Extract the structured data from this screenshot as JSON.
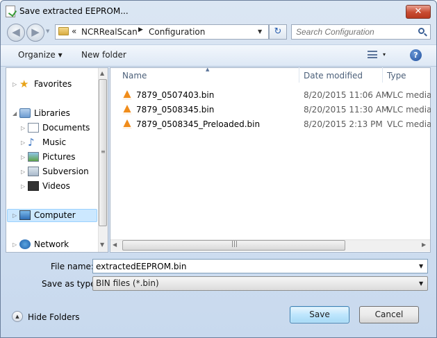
{
  "window": {
    "title": "Save extracted EEPROM...",
    "close_glyph": "✕"
  },
  "nav": {
    "back_glyph": "◀",
    "forward_glyph": "▶",
    "recent_glyph": "▼"
  },
  "address": {
    "overflow": "«",
    "segments": [
      "NCRRealScan",
      "Configuration"
    ],
    "separator": "▶",
    "dropdown_glyph": "▼",
    "refresh_glyph": "↻"
  },
  "search": {
    "placeholder": "Search Configuration"
  },
  "toolbar": {
    "organize_label": "Organize ▾",
    "new_folder_label": "New folder",
    "views_dropdown": "▾",
    "help_glyph": "?"
  },
  "sidebar": {
    "items": [
      {
        "label": "Favorites",
        "icon": "star-icon",
        "expander": "▷"
      },
      {
        "label": "Libraries",
        "icon": "libraries-icon",
        "expander": "◢"
      },
      {
        "label": "Documents",
        "icon": "documents-icon",
        "expander": "▷"
      },
      {
        "label": "Music",
        "icon": "music-icon",
        "expander": "▷"
      },
      {
        "label": "Pictures",
        "icon": "pictures-icon",
        "expander": "▷"
      },
      {
        "label": "Subversion",
        "icon": "subversion-icon",
        "expander": "▷"
      },
      {
        "label": "Videos",
        "icon": "videos-icon",
        "expander": "▷"
      },
      {
        "label": "Computer",
        "icon": "computer-icon",
        "expander": "▷",
        "selected": true
      },
      {
        "label": "Network",
        "icon": "network-icon",
        "expander": "▷"
      }
    ],
    "scroll_up": "▲",
    "scroll_down": "▼",
    "grip": "≡"
  },
  "file_list": {
    "columns": [
      "Name",
      "Date modified",
      "Type"
    ],
    "sort_glyph": "▲",
    "rows": [
      {
        "name": "7879_0507403.bin",
        "date": "8/20/2015 11:06 AM",
        "type": "VLC media file"
      },
      {
        "name": "7879_0508345.bin",
        "date": "8/20/2015 11:30 AM",
        "type": "VLC media file"
      },
      {
        "name": "7879_0508345_Preloaded.bin",
        "date": "8/20/2015 2:13 PM",
        "type": "VLC media file"
      }
    ],
    "scroll_left": "◀",
    "scroll_right": "▶",
    "grip": "|||"
  },
  "form": {
    "filename_label": "File name:",
    "filename_value": "extractedEEPROM.bin",
    "savetype_label": "Save as type:",
    "savetype_value": "BIN files (*.bin)",
    "dropdown_glyph": "▼"
  },
  "footer": {
    "hide_folders_label": "Hide Folders",
    "hide_folders_glyph": "▲",
    "save_label": "Save",
    "cancel_label": "Cancel"
  },
  "colors": {
    "accent": "#3c7fb1",
    "selection": "#cce8ff",
    "vlc_orange": "#f08c1a"
  }
}
